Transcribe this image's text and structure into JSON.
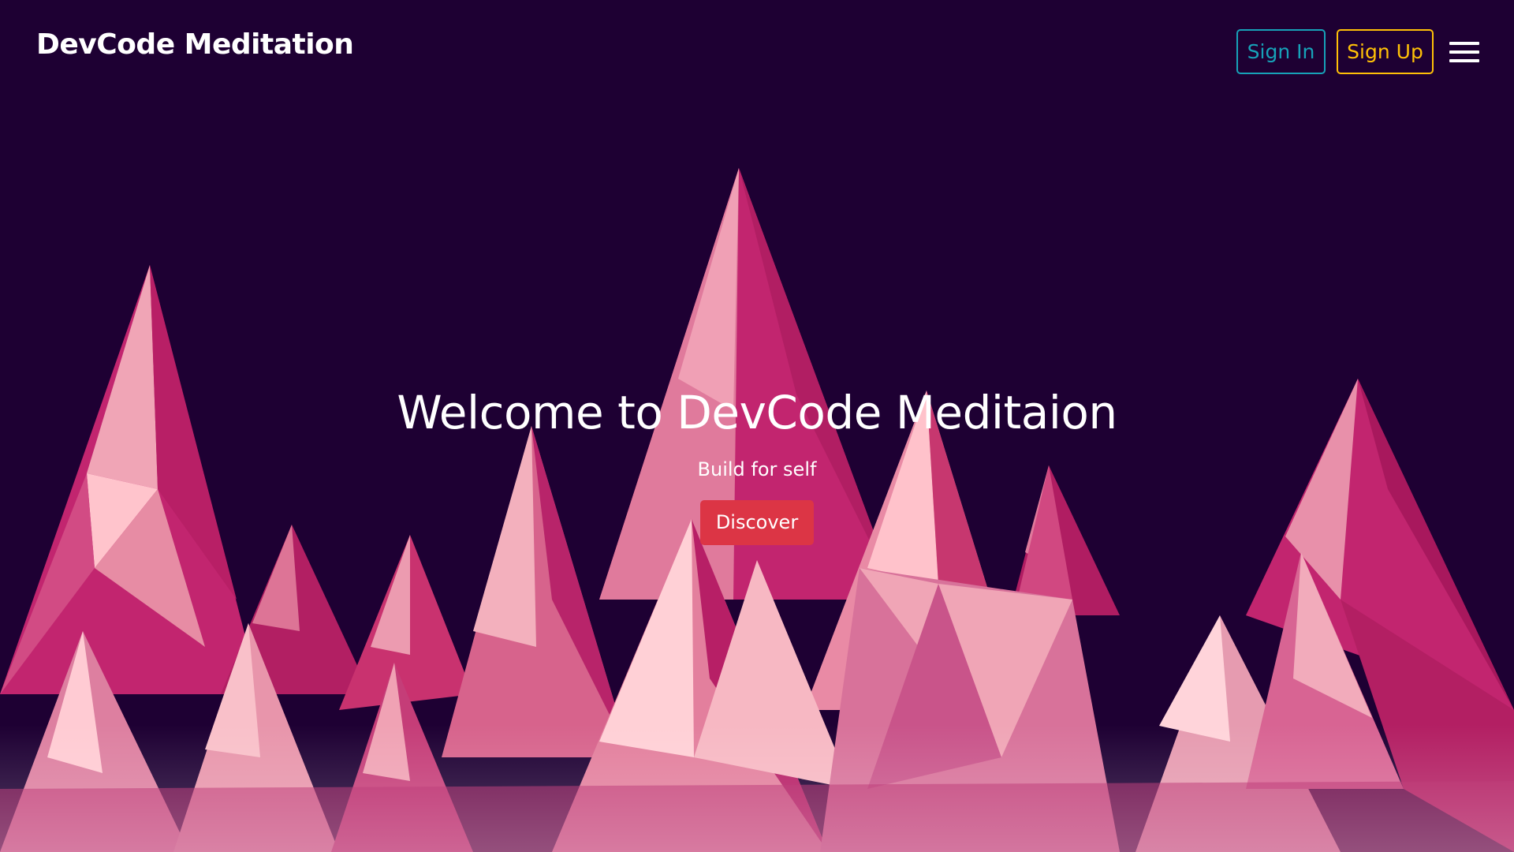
{
  "header": {
    "brand": "DevCode Meditation",
    "sign_in_label": "Sign In",
    "sign_up_label": "Sign Up",
    "menu_icon": "hamburger-menu-icon"
  },
  "hero": {
    "title": "Welcome to DevCode Meditaion",
    "subtitle": "Build for self",
    "cta_label": "Discover"
  },
  "colors": {
    "background": "#1e0033",
    "sign_in_accent": "#17a2b8",
    "sign_up_accent": "#ffc107",
    "cta_background": "#dc3545",
    "mountain_dark": "#a0175f",
    "mountain_mid": "#d9678f",
    "mountain_light": "#ffc7cf"
  }
}
